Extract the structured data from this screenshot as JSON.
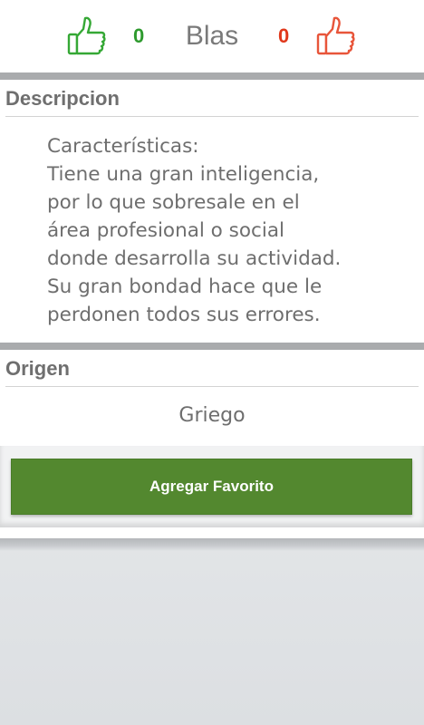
{
  "header": {
    "name": "Blas",
    "likes": "0",
    "dislikes": "0",
    "like_icon": "thumbs-up-icon",
    "dislike_icon": "thumbs-up-icon",
    "like_color": "#2e9a2e",
    "dislike_color": "#e0381b"
  },
  "description": {
    "title": "Descripcion",
    "text": "Características:\nTiene una gran inteligencia,\npor lo que sobresale en el\nárea profesional o social\ndonde desarrolla su actividad.\nSu gran bondad hace que le\nperdonen todos sus errores."
  },
  "origin": {
    "title": "Origen",
    "value": "Griego"
  },
  "actions": {
    "favorite_label": "Agregar Favorito",
    "favorite_color": "#53882f"
  }
}
